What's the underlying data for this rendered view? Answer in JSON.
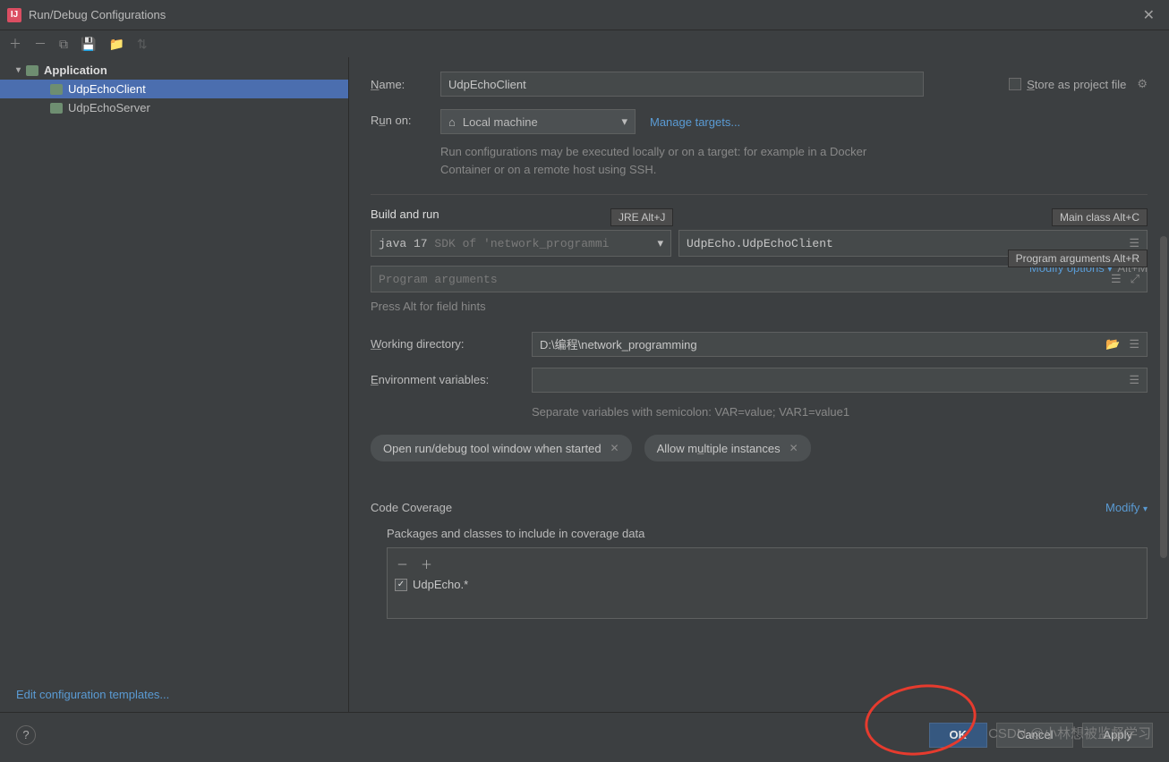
{
  "title": "Run/Debug Configurations",
  "sidebar": {
    "group": "Application",
    "items": [
      "UdpEchoClient",
      "UdpEchoServer"
    ],
    "edit_templates": "Edit configuration templates..."
  },
  "form": {
    "name_label": "Name:",
    "name_value": "UdpEchoClient",
    "store_label": "Store as project file",
    "run_on_label": "Run on:",
    "run_on_value": "Local machine",
    "manage_targets": "Manage targets...",
    "run_on_hint": "Run configurations may be executed locally or on a target: for example in a Docker Container or on a remote host using SSH.",
    "build_title": "Build and run",
    "modify_options": "Modify options",
    "modify_sc": "Alt+M",
    "jre_hint": "JRE Alt+J",
    "main_class_hint": "Main class Alt+C",
    "sdk_a": "java 17",
    "sdk_b": "SDK of 'network_programmi",
    "main_class": "UdpEcho.UdpEchoClient",
    "args_hint": "Program arguments Alt+R",
    "args_placeholder": "Program arguments",
    "alt_hint": "Press Alt for field hints",
    "wd_label": "Working directory:",
    "wd_value": "D:\\编程\\network_programming",
    "env_label": "Environment variables:",
    "env_hint": "Separate variables with semicolon: VAR=value; VAR1=value1",
    "chip_open": "Open run/debug tool window when started",
    "chip_multi": "Allow multiple instances",
    "coverage_title": "Code Coverage",
    "coverage_modify": "Modify",
    "coverage_sub": "Packages and classes to include in coverage data",
    "coverage_item": "UdpEcho.*"
  },
  "footer": {
    "ok": "OK",
    "cancel": "Cancel",
    "apply": "Apply"
  },
  "watermark": "CSDN @小林想被监督学习"
}
